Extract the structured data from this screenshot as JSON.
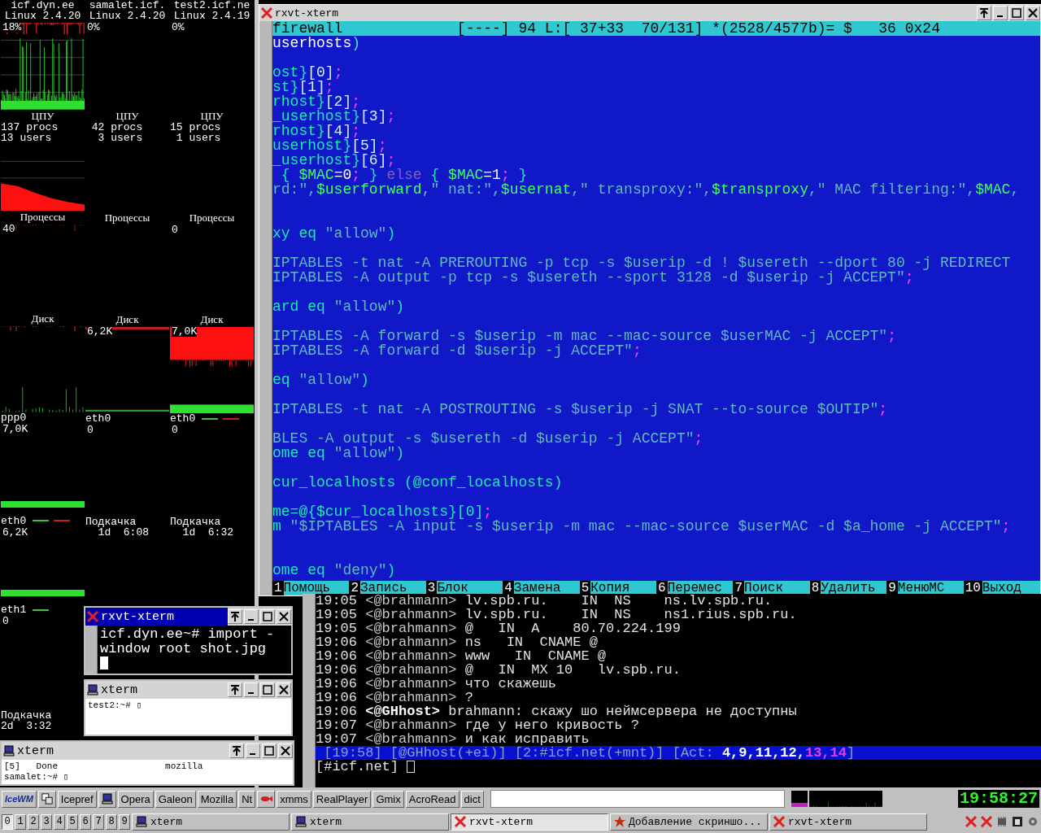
{
  "monitor": {
    "columns": [
      {
        "sections": [
          {
            "kind": "host",
            "name": "icf.dyn.ee",
            "kernel": "Linux 2.4.20",
            "reading": "18%"
          },
          {
            "kind": "cpu",
            "label": "ЦПУ",
            "procs": "137 procs",
            "users": "13 users"
          },
          {
            "kind": "meter",
            "label": "Процессы",
            "reading": "40"
          },
          {
            "kind": "meter",
            "label": "Диск"
          },
          {
            "kind": "net",
            "label": "ppp0",
            "reading": "7,0K"
          },
          {
            "kind": "net",
            "label": "eth0",
            "reading": "6,2K"
          },
          {
            "kind": "net",
            "label": "eth1",
            "reading": "0"
          },
          {
            "kind": "swap",
            "label": "Подкачка",
            "reading": "2d  3:32"
          }
        ]
      },
      {
        "sections": [
          {
            "kind": "host",
            "name": "samalet.icf.",
            "kernel": "Linux 2.4.20",
            "reading": "0%"
          },
          {
            "kind": "cpu",
            "label": "ЦПУ",
            "procs": " 42 procs",
            "users": "  3 users"
          },
          {
            "kind": "meter",
            "label": "Процессы"
          },
          {
            "kind": "meter",
            "label": "Диск",
            "reading": "6,2K"
          },
          {
            "kind": "net",
            "label": "eth0",
            "reading": "0"
          },
          {
            "kind": "swap",
            "label": "Подкачка",
            "reading": "  1d  6:08"
          }
        ]
      },
      {
        "sections": [
          {
            "kind": "host",
            "name": "test2.icf.ne",
            "kernel": "Linux 2.4.19",
            "reading": "0%"
          },
          {
            "kind": "cpu",
            "label": "ЦПУ",
            "procs": "15 procs",
            "users": " 1 users"
          },
          {
            "kind": "meter",
            "label": "Процессы",
            "reading": "0"
          },
          {
            "kind": "meter",
            "label": "Диск",
            "reading": "7,0K"
          },
          {
            "kind": "net",
            "label": "eth0",
            "reading": "0"
          },
          {
            "kind": "swap",
            "label": "Подкачка",
            "reading": "  1d  6:32"
          }
        ]
      }
    ]
  },
  "editor": {
    "title": "rxvt-xterm",
    "kind": "rxvt",
    "active": false,
    "status": "firewall             [----] 94 L:[ 37+33  70/131] *(2528/4577b)= $   36 0x24",
    "lines": [
      {
        "kind": "code",
        "segments": [
          {
            "text": "userhosts",
            "kind": "plain"
          },
          {
            "text": ")",
            "kind": "paren"
          }
        ]
      },
      {
        "kind": "blank"
      },
      {
        "kind": "code",
        "segments": [
          {
            "text": "ost}",
            "kind": "ident"
          },
          {
            "text": "[0]",
            "kind": "index"
          },
          {
            "text": ";",
            "kind": "punct"
          }
        ]
      },
      {
        "kind": "code",
        "segments": [
          {
            "text": "st}",
            "kind": "ident"
          },
          {
            "text": "[1]",
            "kind": "index"
          },
          {
            "text": ";",
            "kind": "punct"
          }
        ]
      },
      {
        "kind": "code",
        "segments": [
          {
            "text": "rhost}",
            "kind": "ident"
          },
          {
            "text": "[2]",
            "kind": "index"
          },
          {
            "text": ";",
            "kind": "punct"
          }
        ]
      },
      {
        "kind": "code",
        "segments": [
          {
            "text": "_userhost}",
            "kind": "ident"
          },
          {
            "text": "[3]",
            "kind": "index"
          },
          {
            "text": ";",
            "kind": "punct"
          }
        ]
      },
      {
        "kind": "code",
        "segments": [
          {
            "text": "rhost}",
            "kind": "ident"
          },
          {
            "text": "[4]",
            "kind": "index"
          },
          {
            "text": ";",
            "kind": "punct"
          }
        ]
      },
      {
        "kind": "code",
        "segments": [
          {
            "text": "userhost}",
            "kind": "ident"
          },
          {
            "text": "[5]",
            "kind": "index"
          },
          {
            "text": ";",
            "kind": "punct"
          }
        ]
      },
      {
        "kind": "code",
        "segments": [
          {
            "text": "_userhost}",
            "kind": "ident"
          },
          {
            "text": "[6]",
            "kind": "index"
          },
          {
            "text": ";",
            "kind": "punct"
          }
        ]
      },
      {
        "kind": "code",
        "segments": [
          {
            "text": " { ",
            "kind": "ident"
          },
          {
            "text": "$MAC",
            "kind": "variable"
          },
          {
            "text": "=0",
            "kind": "plain"
          },
          {
            "text": ";",
            "kind": "punct"
          },
          {
            "text": " } ",
            "kind": "ident"
          },
          {
            "text": "else",
            "kind": "keyword"
          },
          {
            "text": " { ",
            "kind": "ident"
          },
          {
            "text": "$MAC",
            "kind": "variable"
          },
          {
            "text": "=1",
            "kind": "plain"
          },
          {
            "text": ";",
            "kind": "punct"
          },
          {
            "text": " }",
            "kind": "ident"
          }
        ]
      },
      {
        "kind": "code",
        "segments": [
          {
            "text": "rd:\",",
            "kind": "string"
          },
          {
            "text": "$userforward",
            "kind": "variable"
          },
          {
            "text": ",\" nat:\",",
            "kind": "string"
          },
          {
            "text": "$usernat",
            "kind": "variable"
          },
          {
            "text": ",\" transproxy:\",",
            "kind": "string"
          },
          {
            "text": "$transproxy",
            "kind": "variable"
          },
          {
            "text": ",\" MAC filtering:\",",
            "kind": "string"
          },
          {
            "text": "$MAC",
            "kind": "variable"
          },
          {
            "text": ",",
            "kind": "string"
          }
        ]
      },
      {
        "kind": "blank"
      },
      {
        "kind": "blank"
      },
      {
        "kind": "code",
        "segments": [
          {
            "text": "xy eq ",
            "kind": "ident"
          },
          {
            "text": "\"allow\"",
            "kind": "string"
          },
          {
            "text": ")",
            "kind": "ident"
          }
        ]
      },
      {
        "kind": "blank"
      },
      {
        "kind": "code",
        "segments": [
          {
            "text": "IPTABLES -t nat -A PREROUTING -p tcp -s $userip -d ! $usereth --dport 80 -j REDIRECT",
            "kind": "string"
          }
        ]
      },
      {
        "kind": "code",
        "segments": [
          {
            "text": "IPTABLES -A output -p tcp -s $usereth --sport 3128 -d $userip -j ACCEPT\"",
            "kind": "string"
          },
          {
            "text": ";",
            "kind": "punct"
          }
        ]
      },
      {
        "kind": "blank"
      },
      {
        "kind": "code",
        "segments": [
          {
            "text": "ard eq ",
            "kind": "ident"
          },
          {
            "text": "\"allow\"",
            "kind": "string"
          },
          {
            "text": ")",
            "kind": "ident"
          }
        ]
      },
      {
        "kind": "blank"
      },
      {
        "kind": "code",
        "segments": [
          {
            "text": "IPTABLES -A forward -s $userip -m mac --mac-source $userMAC -j ACCEPT\"",
            "kind": "string"
          },
          {
            "text": ";",
            "kind": "punct"
          }
        ]
      },
      {
        "kind": "code",
        "segments": [
          {
            "text": "IPTABLES -A forward -d $userip -j ACCEPT\"",
            "kind": "string"
          },
          {
            "text": ";",
            "kind": "punct"
          }
        ]
      },
      {
        "kind": "blank"
      },
      {
        "kind": "code",
        "segments": [
          {
            "text": "eq ",
            "kind": "ident"
          },
          {
            "text": "\"allow\"",
            "kind": "string"
          },
          {
            "text": ")",
            "kind": "ident"
          }
        ]
      },
      {
        "kind": "blank"
      },
      {
        "kind": "code",
        "segments": [
          {
            "text": "IPTABLES -t nat -A POSTROUTING -s $userip -j SNAT --to-source $OUTIP\"",
            "kind": "string"
          },
          {
            "text": ";",
            "kind": "punct"
          }
        ]
      },
      {
        "kind": "blank"
      },
      {
        "kind": "code",
        "segments": [
          {
            "text": "BLES -A output -s $usereth -d $userip -j ACCEPT\"",
            "kind": "string"
          },
          {
            "text": ";",
            "kind": "punct"
          }
        ]
      },
      {
        "kind": "code",
        "segments": [
          {
            "text": "ome eq ",
            "kind": "ident"
          },
          {
            "text": "\"allow\"",
            "kind": "string"
          },
          {
            "text": ")",
            "kind": "ident"
          }
        ]
      },
      {
        "kind": "blank"
      },
      {
        "kind": "code",
        "segments": [
          {
            "text": "cur_localhosts (@conf_localhosts)",
            "kind": "ident"
          }
        ]
      },
      {
        "kind": "blank"
      },
      {
        "kind": "code",
        "segments": [
          {
            "text": "me=@{$cur_localhosts}[0]",
            "kind": "ident"
          },
          {
            "text": ";",
            "kind": "punct"
          }
        ]
      },
      {
        "kind": "code",
        "segments": [
          {
            "text": "m ",
            "kind": "ident"
          },
          {
            "text": "\"$IPTABLES -A input -s $userip -m mac --mac-source $userMAC -d $a_home -j ACCEPT\"",
            "kind": "string"
          },
          {
            "text": ";",
            "kind": "punct"
          }
        ]
      },
      {
        "kind": "blank"
      },
      {
        "kind": "blank"
      },
      {
        "kind": "code",
        "segments": [
          {
            "text": "ome eq ",
            "kind": "ident"
          },
          {
            "text": "\"deny\"",
            "kind": "string"
          },
          {
            "text": ")",
            "kind": "ident"
          }
        ]
      }
    ],
    "fkeys": [
      {
        "number": "1",
        "label": "Помощь"
      },
      {
        "number": "2",
        "label": "Запись"
      },
      {
        "number": "3",
        "label": "Блок"
      },
      {
        "number": "4",
        "label": "Замена"
      },
      {
        "number": "5",
        "label": "Копия"
      },
      {
        "number": "6",
        "label": "Перемес"
      },
      {
        "number": "7",
        "label": "Поиск"
      },
      {
        "number": "8",
        "label": "Удалить"
      },
      {
        "number": "9",
        "label": "МенюМС"
      },
      {
        "number": "10",
        "label": "Выход"
      }
    ]
  },
  "irc": {
    "lines": [
      {
        "time": "19:05",
        "nick": "<@brahmann>",
        "bold": false,
        "text": "lv.spb.ru.    IN  NS    ns.lv.spb.ru."
      },
      {
        "time": "19:05",
        "nick": "<@brahmann>",
        "bold": false,
        "text": "lv.spb.ru.    IN  NS    ns1.rius.spb.ru."
      },
      {
        "time": "19:05",
        "nick": "<@brahmann>",
        "bold": false,
        "text": "@   IN  A    80.70.224.199"
      },
      {
        "time": "19:06",
        "nick": "<@brahmann>",
        "bold": false,
        "text": "ns   IN  CNAME @"
      },
      {
        "time": "19:06",
        "nick": "<@brahmann>",
        "bold": false,
        "text": "www   IN  CNAME @"
      },
      {
        "time": "19:06",
        "nick": "<@brahmann>",
        "bold": false,
        "text": "@   IN  MX 10   lv.spb.ru."
      },
      {
        "time": "19:06",
        "nick": "<@brahmann>",
        "bold": false,
        "text": "что скажешь"
      },
      {
        "time": "19:06",
        "nick": "<@brahmann>",
        "bold": false,
        "text": "?"
      },
      {
        "time": "19:06",
        "nick": "<@GHhost>",
        "bold": true,
        "text": "brahmann: скажу шо неймсервера не доступны"
      },
      {
        "time": "19:07",
        "nick": "<@brahmann>",
        "bold": false,
        "text": "где у него кривость ?"
      },
      {
        "time": "19:07",
        "nick": "<@brahmann>",
        "bold": false,
        "text": "и как исправить"
      }
    ],
    "status": {
      "items": [
        "[19:58]",
        "[@GHhost(+ei)]",
        "[2:#icf.net(+mnt)]"
      ],
      "act_label": "[Act:",
      "act": [
        {
          "text": "4,",
          "kind": "active"
        },
        {
          "text": "9,",
          "kind": "active"
        },
        {
          "text": "11,",
          "kind": "active"
        },
        {
          "text": "12,",
          "kind": "active"
        },
        {
          "text": "13,",
          "kind": "highlight"
        },
        {
          "text": "14",
          "kind": "highlight"
        }
      ],
      "act_end": "]"
    },
    "prompt": "[#icf.net]"
  },
  "xterms": [
    {
      "title": "rxvt-xterm",
      "kind": "rxvt",
      "active": true,
      "lines": [
        "icf.dyn.ee~# import -",
        "window root shot.jpg"
      ]
    },
    {
      "title": "xterm",
      "kind": "xterm",
      "active": false,
      "lines": [
        "test2:~# ▯"
      ]
    },
    {
      "title": "xterm",
      "kind": "xterm",
      "active": false,
      "lines": [
        "[5]   Done                    mozilla",
        "samalet:~# ▯"
      ]
    }
  ],
  "taskbar": {
    "start_label": "IceWM",
    "launchers": [
      {
        "kind": "windows"
      },
      {
        "kind": "text",
        "label": "Icepref"
      },
      {
        "kind": "monitor"
      },
      {
        "kind": "text",
        "label": "Opera"
      },
      {
        "kind": "text",
        "label": "Galeon"
      },
      {
        "kind": "text",
        "label": "Mozilla"
      },
      {
        "kind": "text",
        "label": "Nt"
      },
      {
        "kind": "fish"
      },
      {
        "kind": "text",
        "label": "xmms"
      },
      {
        "kind": "text",
        "label": "RealPlayer"
      },
      {
        "kind": "text",
        "label": "Gmix"
      },
      {
        "kind": "text",
        "label": "AcroRead"
      },
      {
        "kind": "text",
        "label": "dict"
      }
    ],
    "clock": "19:58:27",
    "workspaces": [
      {
        "label": "0",
        "selected": true
      },
      {
        "label": "1",
        "selected": false
      },
      {
        "label": "2",
        "selected": false
      },
      {
        "label": "3",
        "selected": false
      },
      {
        "label": "4",
        "selected": false
      },
      {
        "label": "5",
        "selected": false
      },
      {
        "label": "6",
        "selected": false
      },
      {
        "label": "7",
        "selected": false
      },
      {
        "label": "8",
        "selected": false
      },
      {
        "label": "9",
        "selected": false
      }
    ],
    "tasks": [
      {
        "kind": "xterm",
        "title": "xterm",
        "selected": false
      },
      {
        "kind": "xterm",
        "title": "xterm",
        "selected": false
      },
      {
        "kind": "rxvt",
        "title": "rxvt-xterm",
        "selected": true
      },
      {
        "kind": "star",
        "title": "Добавление скриншо...",
        "selected": false
      },
      {
        "kind": "rxvt",
        "title": "rxvt-xterm",
        "selected": false
      }
    ]
  }
}
